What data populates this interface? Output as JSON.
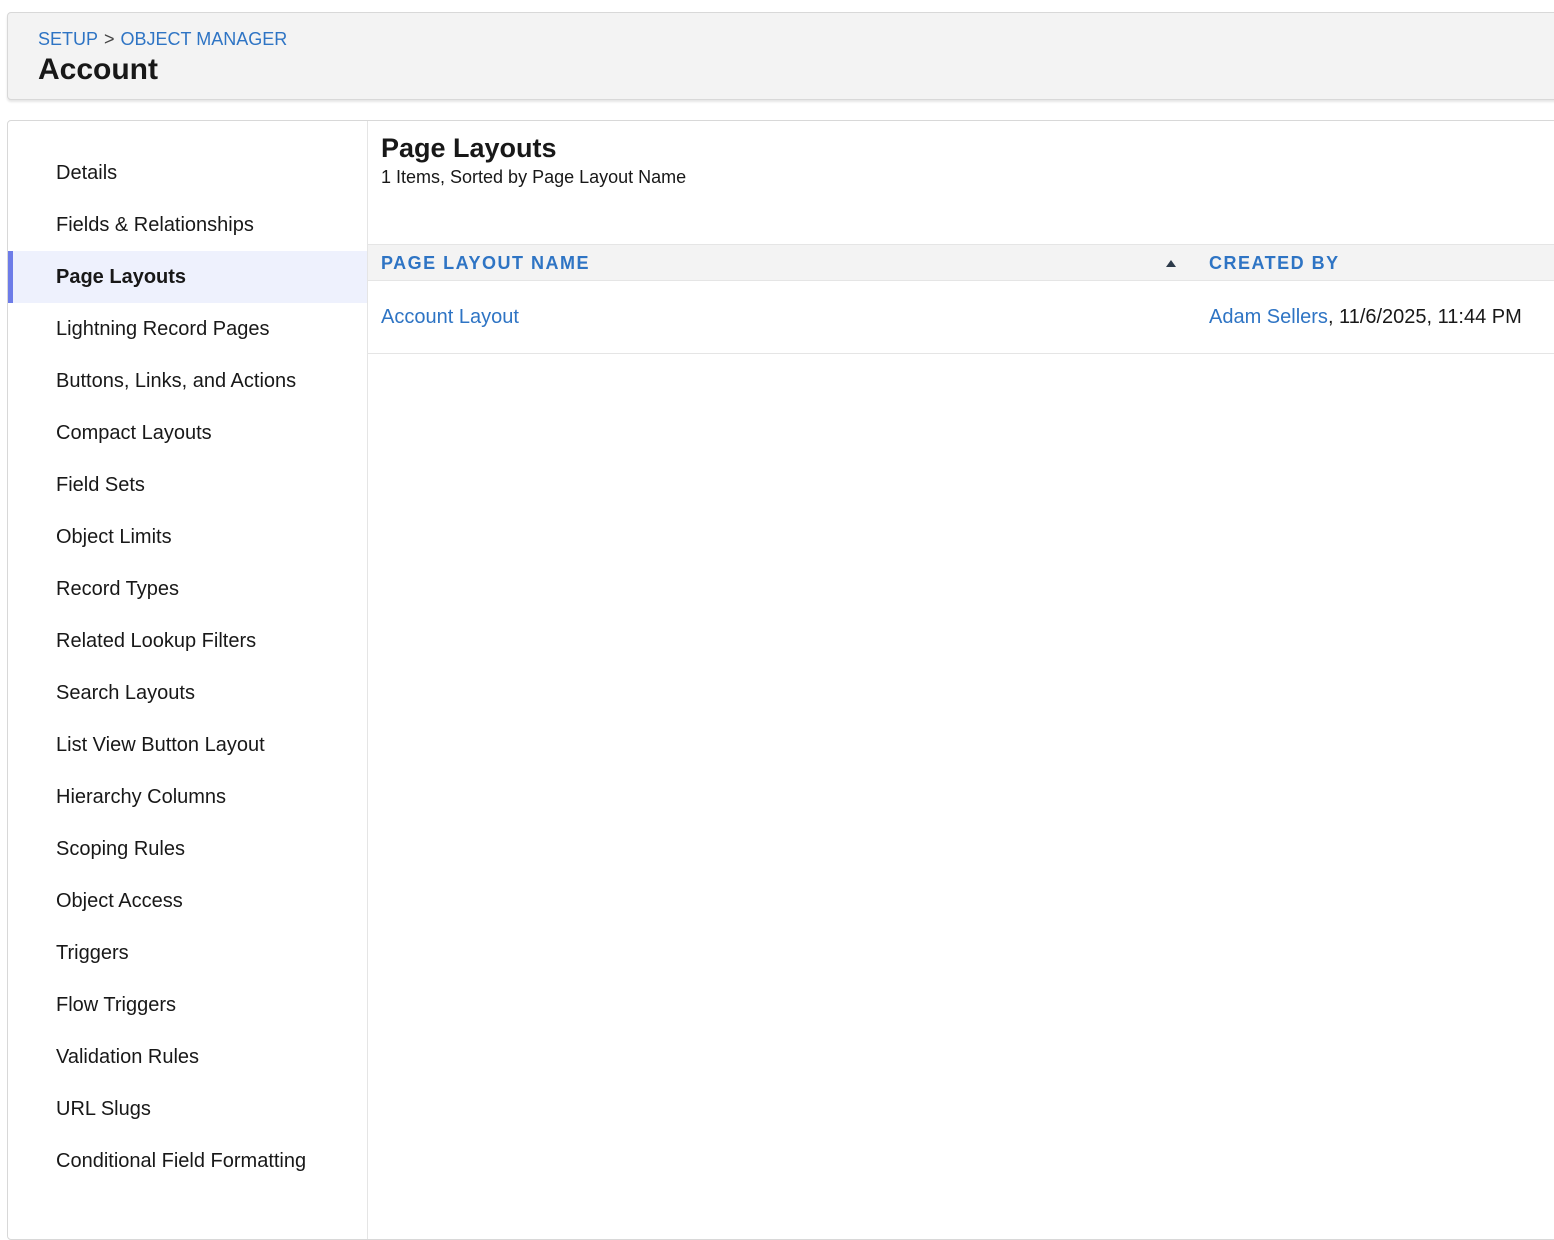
{
  "header": {
    "breadcrumb": {
      "setup": "SETUP",
      "separator": ">",
      "object_manager": "OBJECT MANAGER"
    },
    "title": "Account"
  },
  "sidebar": {
    "items": [
      {
        "label": "Details",
        "active": false
      },
      {
        "label": "Fields & Relationships",
        "active": false
      },
      {
        "label": "Page Layouts",
        "active": true
      },
      {
        "label": "Lightning Record Pages",
        "active": false
      },
      {
        "label": "Buttons, Links, and Actions",
        "active": false
      },
      {
        "label": "Compact Layouts",
        "active": false
      },
      {
        "label": "Field Sets",
        "active": false
      },
      {
        "label": "Object Limits",
        "active": false
      },
      {
        "label": "Record Types",
        "active": false
      },
      {
        "label": "Related Lookup Filters",
        "active": false
      },
      {
        "label": "Search Layouts",
        "active": false
      },
      {
        "label": "List View Button Layout",
        "active": false
      },
      {
        "label": "Hierarchy Columns",
        "active": false
      },
      {
        "label": "Scoping Rules",
        "active": false
      },
      {
        "label": "Object Access",
        "active": false
      },
      {
        "label": "Triggers",
        "active": false
      },
      {
        "label": "Flow Triggers",
        "active": false
      },
      {
        "label": "Validation Rules",
        "active": false
      },
      {
        "label": "URL Slugs",
        "active": false
      },
      {
        "label": "Conditional Field Formatting",
        "active": false
      }
    ]
  },
  "main": {
    "title": "Page Layouts",
    "subtitle": "1 Items, Sorted by Page Layout Name",
    "table": {
      "columns": {
        "name": "PAGE LAYOUT NAME",
        "created_by": "CREATED BY"
      },
      "sort": {
        "column": "name",
        "direction": "ascending",
        "icon": "sort-ascending-icon"
      },
      "rows": [
        {
          "name": "Account Layout",
          "created_by_user": "Adam Sellers",
          "created_by_date": ", 11/6/2025, 11:44 PM"
        }
      ]
    }
  },
  "colors": {
    "link": "#2e74c4",
    "active_indicator": "#6d7ce8",
    "active_background": "#eef1fd",
    "header_background": "#f3f3f3"
  }
}
